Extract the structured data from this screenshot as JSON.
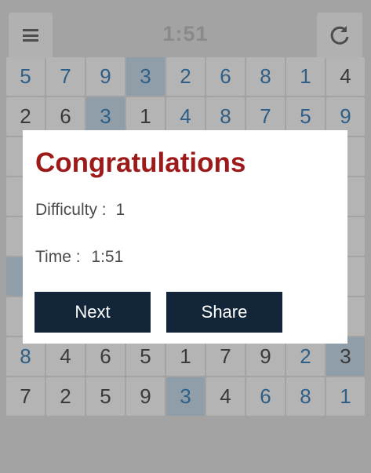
{
  "header": {
    "timer": "1:51",
    "menu_icon": "menu-icon",
    "reset_icon": "refresh-icon"
  },
  "board": {
    "rows": [
      [
        "5",
        "7",
        "9",
        "3",
        "2",
        "6",
        "8",
        "1",
        "4"
      ],
      [
        "2",
        "6",
        "3",
        "1",
        "4",
        "8",
        "7",
        "5",
        "9"
      ],
      [
        "",
        "",
        "",
        "",
        "",
        "",
        "",
        "",
        ""
      ],
      [
        "",
        "",
        "",
        "",
        "",
        "",
        "",
        "",
        ""
      ],
      [
        "",
        "",
        "",
        "",
        "",
        "",
        "",
        "",
        ""
      ],
      [
        "",
        "",
        "",
        "",
        "",
        "",
        "",
        "",
        ""
      ],
      [
        "",
        "",
        "",
        "",
        "",
        "",
        "",
        "",
        ""
      ],
      [
        "8",
        "4",
        "6",
        "5",
        "1",
        "7",
        "9",
        "2",
        "3"
      ],
      [
        "7",
        "2",
        "5",
        "9",
        "3",
        "4",
        "6",
        "8",
        "1"
      ]
    ],
    "colors": {
      "given": "#3a3a3a",
      "entered": "#2f5f86",
      "highlight": "#8f9ea8"
    }
  },
  "dialog": {
    "title": "Congratulations",
    "difficulty_label": "Difficulty :",
    "difficulty_value": "1",
    "time_label": "Time :",
    "time_value": "1:51",
    "next_label": "Next",
    "share_label": "Share"
  }
}
